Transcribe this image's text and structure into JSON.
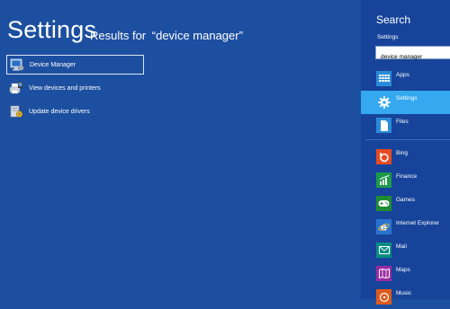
{
  "main": {
    "title": "Settings",
    "results_prefix": "Results for",
    "results_query": "“device manager”",
    "results": [
      {
        "label": "Device Manager",
        "icon": "device-manager-icon",
        "selected": true
      },
      {
        "label": "View devices and printers",
        "icon": "devices-printers-icon",
        "selected": false
      },
      {
        "label": "Update device drivers",
        "icon": "update-drivers-icon",
        "selected": false
      }
    ]
  },
  "search_pane": {
    "title": "Search",
    "scope_label": "Settings",
    "query": "device manager",
    "scopes": [
      {
        "label": "Apps",
        "icon": "apps-icon",
        "color": "#2b8bd8",
        "selected": false
      },
      {
        "label": "Settings",
        "icon": "gear-icon",
        "color": "#35a8f0",
        "selected": true
      },
      {
        "label": "Files",
        "icon": "file-icon",
        "color": "#2b8bd8",
        "selected": false
      }
    ],
    "apps": [
      {
        "label": "Bing",
        "icon": "bing-icon",
        "color": "#e84a23"
      },
      {
        "label": "Finance",
        "icon": "finance-icon",
        "color": "#1f9a48"
      },
      {
        "label": "Games",
        "icon": "games-icon",
        "color": "#1e8c33"
      },
      {
        "label": "Internet Explorer",
        "icon": "internet-explorer-icon",
        "color": "#2a74d0"
      },
      {
        "label": "Mail",
        "icon": "mail-icon",
        "color": "#0a8c84"
      },
      {
        "label": "Maps",
        "icon": "maps-icon",
        "color": "#9b2ba4"
      },
      {
        "label": "Music",
        "icon": "music-icon",
        "color": "#e05a1c"
      }
    ]
  }
}
